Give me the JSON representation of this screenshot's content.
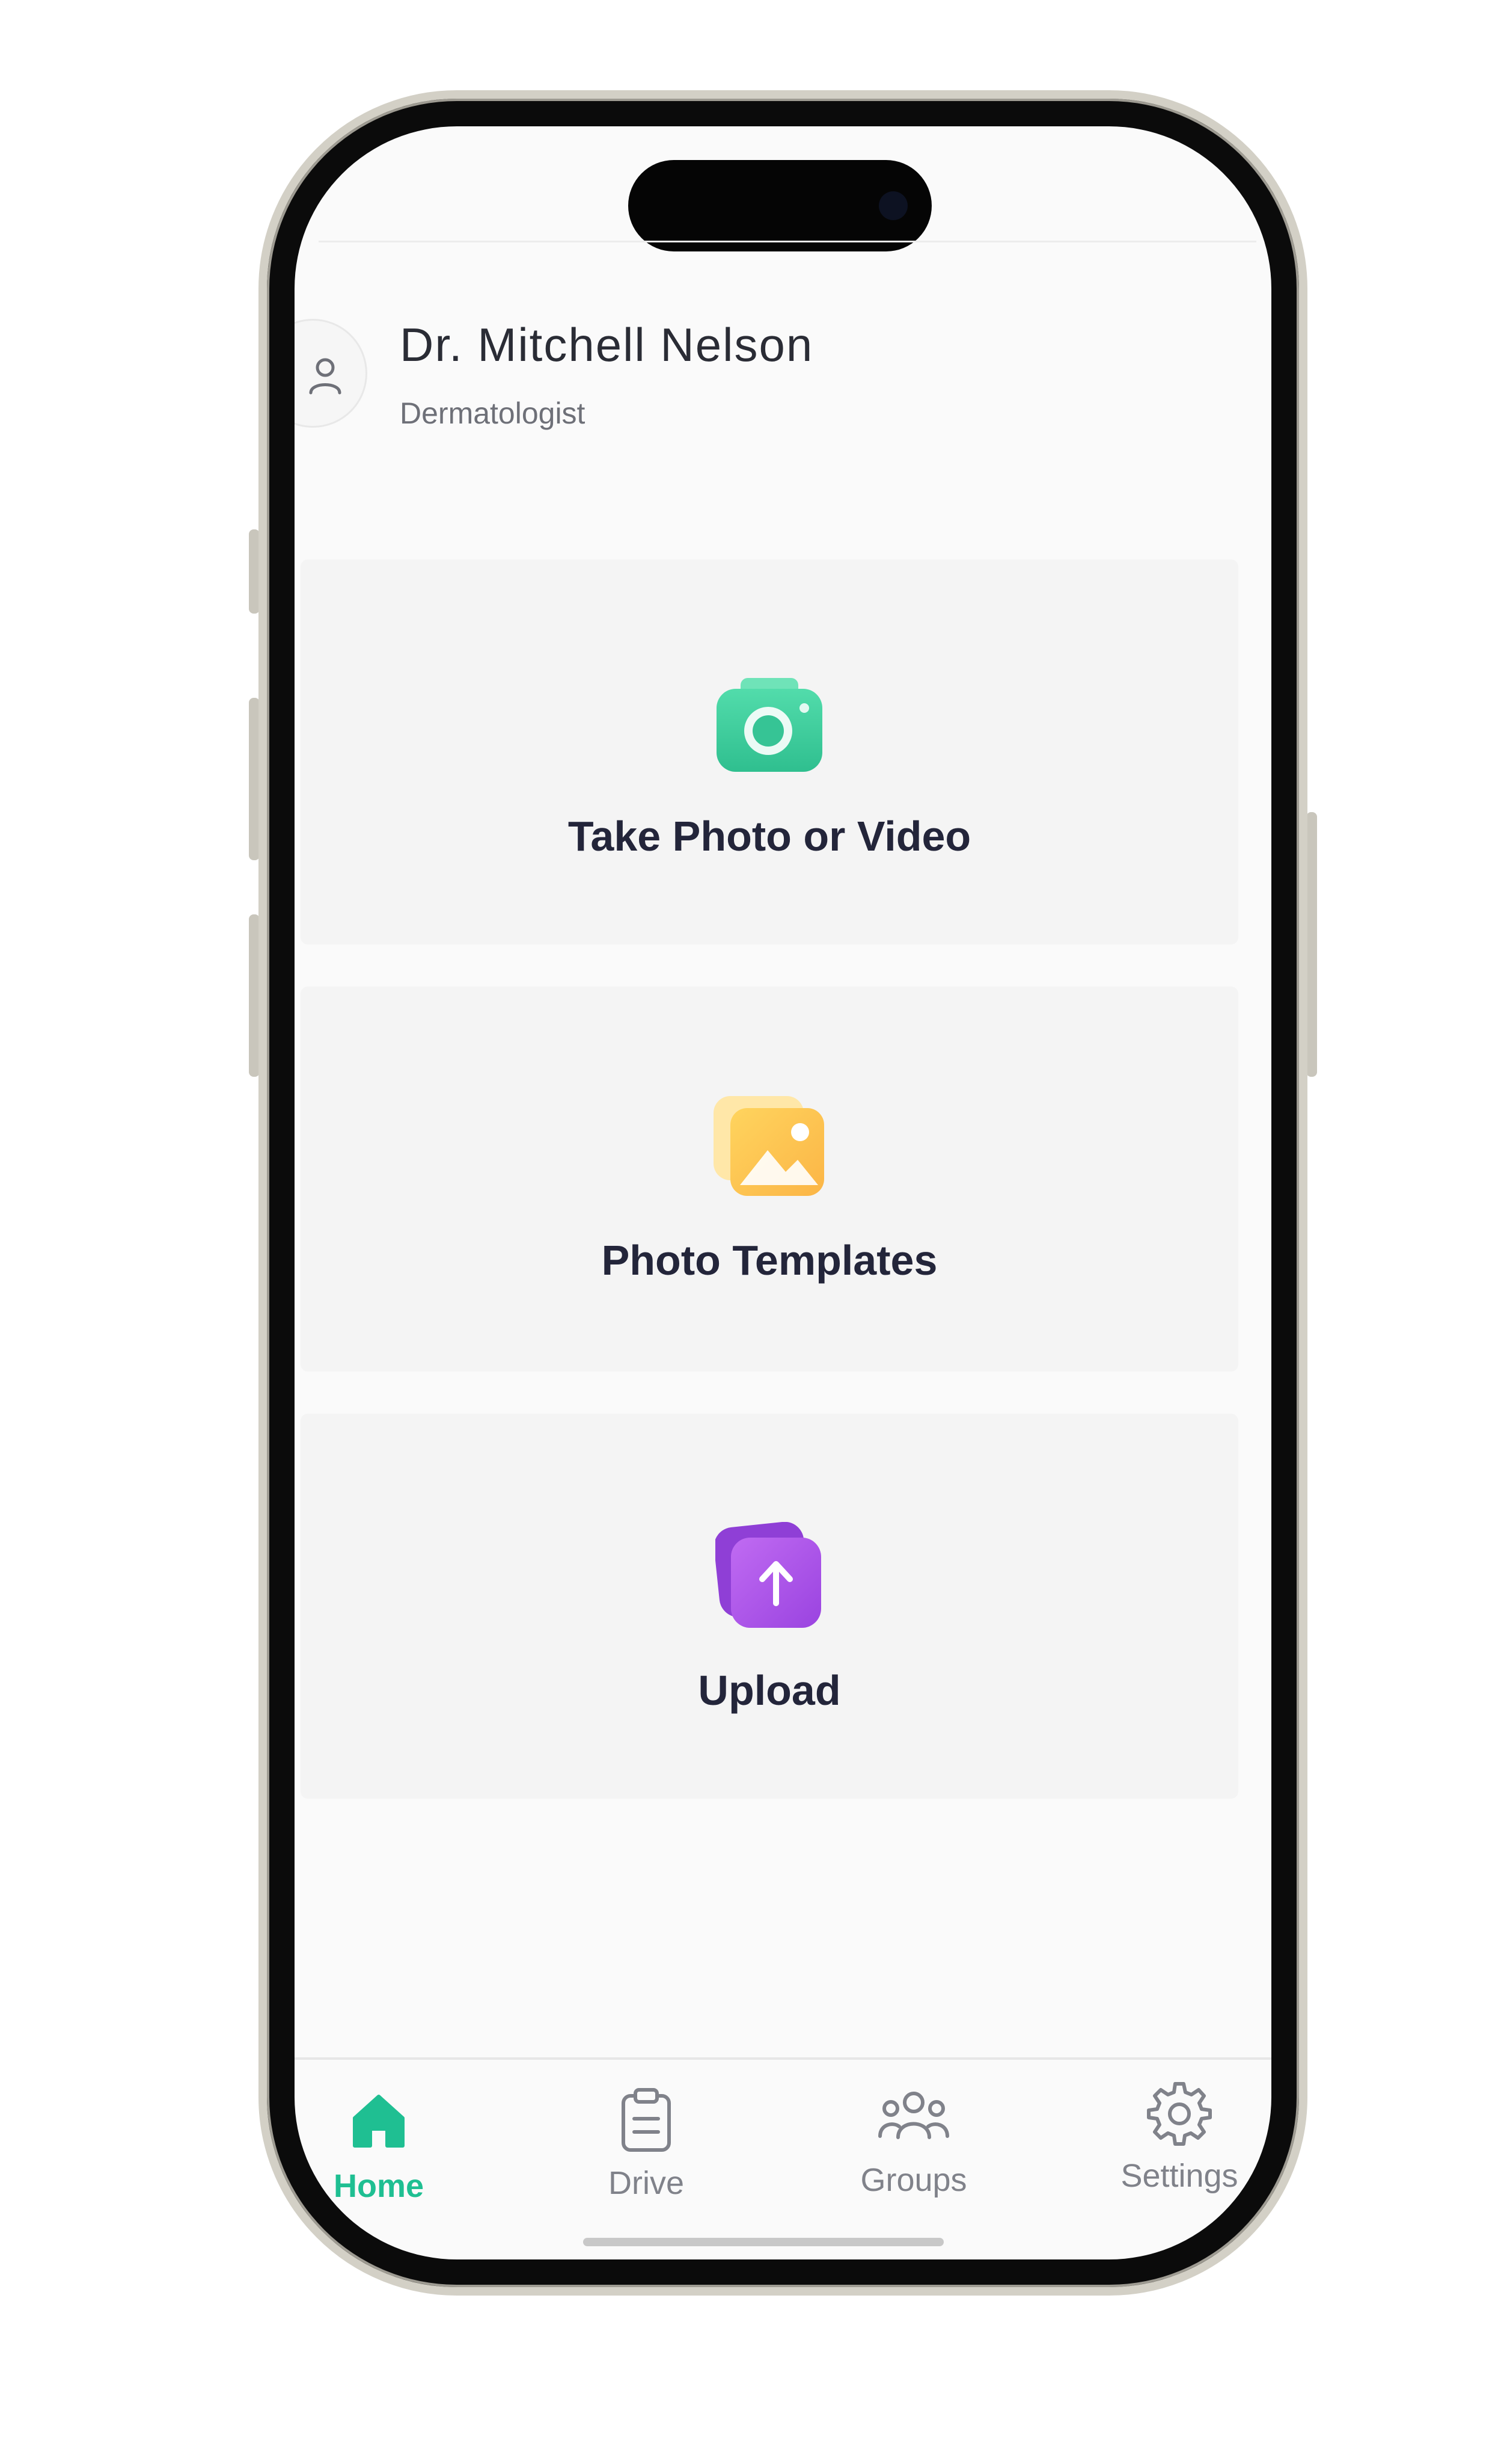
{
  "profile": {
    "name": "Dr. Mitchell Nelson",
    "role": "Dermatologist"
  },
  "actions": [
    {
      "label": "Take Photo or Video",
      "icon": "camera-icon",
      "color": "#3ecf9f"
    },
    {
      "label": "Photo Templates",
      "icon": "image-icon",
      "color": "#fdc34f"
    },
    {
      "label": "Upload",
      "icon": "upload-icon",
      "color": "#a24ee6"
    }
  ],
  "nav": {
    "items": [
      {
        "label": "Home",
        "icon": "home-icon",
        "active": true
      },
      {
        "label": "Drive",
        "icon": "clipboard-icon",
        "active": false
      },
      {
        "label": "Groups",
        "icon": "group-icon",
        "active": false
      },
      {
        "label": "Settings",
        "icon": "gear-icon",
        "active": false
      }
    ],
    "active_color": "#1fbf92",
    "inactive_color": "#80828a"
  }
}
